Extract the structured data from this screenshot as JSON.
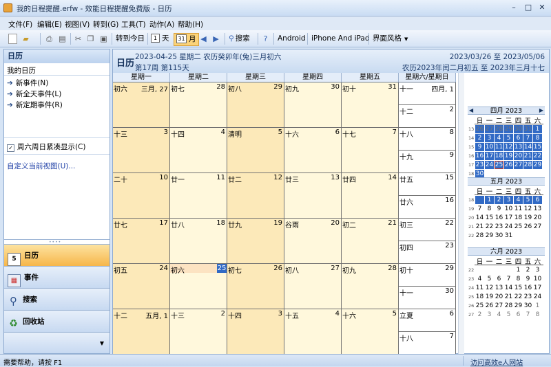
{
  "window": {
    "title": "我的日程提醒.erfw - 效能日程提醒免费版 - 日历",
    "min_label": "–",
    "max_label": "□",
    "close_label": "✕"
  },
  "menu": [
    "文件(F)",
    "编辑(E)",
    "视图(V)",
    "转到(G)",
    "工具(T)",
    "动作(A)",
    "帮助(H)"
  ],
  "toolbar": {
    "goto_today": "转到今日",
    "day_label": "天",
    "day_icon": "1",
    "month_label": "月",
    "month_icon": "31",
    "search": "搜索",
    "android": "Android",
    "iphone": "iPhone And iPad",
    "style": "界面风格"
  },
  "left": {
    "header": "日历",
    "my_calendar": "我的日历",
    "actions": [
      "新事件(N)",
      "新全天事件(L)",
      "新定期事件(R)"
    ],
    "compact_weekend": "周六周日紧凑显示(C)",
    "custom_view": "自定义当前视图(U)...",
    "nav": [
      "日历",
      "事件",
      "搜索",
      "回收站"
    ],
    "nav_icons": [
      "calendar-icon",
      "events-icon",
      "search-icon",
      "recycle-icon"
    ]
  },
  "calendar": {
    "title": "日历",
    "date_line": "2023-04-25 星期二 农历癸卯年(兔)三月初六",
    "week_line": "第17周 第115天",
    "range": "2023/03/26 至 2023/05/06",
    "lunar_range": "农历2023年闰二月初五 至 2023年三月十七",
    "weekdays": [
      "星期一",
      "星期二",
      "星期三",
      "星期四",
      "星期五",
      "星期六/星期日"
    ],
    "weeks": [
      {
        "days": [
          [
            "初六",
            "三月, 27"
          ],
          [
            "初七",
            "28"
          ],
          [
            "初八",
            "29"
          ],
          [
            "初九",
            "30"
          ],
          [
            "初十",
            "31"
          ]
        ],
        "weekend": [
          [
            "十一",
            "四月, 1"
          ],
          [
            "十二",
            "2"
          ]
        ]
      },
      {
        "days": [
          [
            "十三",
            "3"
          ],
          [
            "十四",
            "4"
          ],
          [
            "清明",
            "5"
          ],
          [
            "十六",
            "6"
          ],
          [
            "十七",
            "7"
          ]
        ],
        "weekend": [
          [
            "十八",
            "8"
          ],
          [
            "十九",
            "9"
          ]
        ]
      },
      {
        "days": [
          [
            "二十",
            "10"
          ],
          [
            "廿一",
            "11"
          ],
          [
            "廿二",
            "12"
          ],
          [
            "廿三",
            "13"
          ],
          [
            "廿四",
            "14"
          ]
        ],
        "weekend": [
          [
            "廿五",
            "15"
          ],
          [
            "廿六",
            "16"
          ]
        ]
      },
      {
        "days": [
          [
            "廿七",
            "17"
          ],
          [
            "廿八",
            "18"
          ],
          [
            "廿九",
            "19"
          ],
          [
            "谷雨",
            "20"
          ],
          [
            "初二",
            "21"
          ]
        ],
        "weekend": [
          [
            "初三",
            "22"
          ],
          [
            "初四",
            "23"
          ]
        ]
      },
      {
        "days": [
          [
            "初五",
            "24"
          ],
          [
            "初六",
            "25"
          ],
          [
            "初七",
            "26"
          ],
          [
            "初八",
            "27"
          ],
          [
            "初九",
            "28"
          ]
        ],
        "weekend": [
          [
            "初十",
            "29"
          ],
          [
            "十一",
            "30"
          ]
        ]
      },
      {
        "days": [
          [
            "十二",
            "五月, 1"
          ],
          [
            "十三",
            "2"
          ],
          [
            "十四",
            "3"
          ],
          [
            "十五",
            "4"
          ],
          [
            "十六",
            "5"
          ]
        ],
        "weekend": [
          [
            "立夏",
            "6"
          ],
          [
            "十八",
            "7"
          ]
        ]
      }
    ]
  },
  "mini": {
    "dow": [
      "日",
      "一",
      "二",
      "三",
      "四",
      "五",
      "六"
    ],
    "months": [
      {
        "title": "四月 2023",
        "weeks": [
          "13",
          "14",
          "15",
          "16",
          "17",
          "18"
        ],
        "rows": [
          [
            "26",
            "27",
            "28",
            "29",
            "30",
            "31",
            "1"
          ],
          [
            "2",
            "3",
            "4",
            "5",
            "6",
            "7",
            "8"
          ],
          [
            "9",
            "10",
            "11",
            "12",
            "13",
            "14",
            "15"
          ],
          [
            "16",
            "17",
            "18",
            "19",
            "20",
            "21",
            "22"
          ],
          [
            "23",
            "24",
            "25",
            "26",
            "27",
            "28",
            "29"
          ],
          [
            "30",
            "",
            "",
            "",
            "",
            "",
            ""
          ]
        ]
      },
      {
        "title": "五月 2023",
        "weeks": [
          "18",
          "19",
          "20",
          "21",
          "22"
        ],
        "rows": [
          [
            "",
            "1",
            "2",
            "3",
            "4",
            "5",
            "6"
          ],
          [
            "7",
            "8",
            "9",
            "10",
            "11",
            "12",
            "13"
          ],
          [
            "14",
            "15",
            "16",
            "17",
            "18",
            "19",
            "20"
          ],
          [
            "21",
            "22",
            "23",
            "24",
            "25",
            "26",
            "27"
          ],
          [
            "28",
            "29",
            "30",
            "31",
            "",
            "",
            ""
          ]
        ]
      },
      {
        "title": "六月 2023",
        "weeks": [
          "22",
          "23",
          "24",
          "25",
          "26",
          "27"
        ],
        "rows": [
          [
            "",
            "",
            "",
            "",
            "1",
            "2",
            "3"
          ],
          [
            "4",
            "5",
            "6",
            "7",
            "8",
            "9",
            "10"
          ],
          [
            "11",
            "12",
            "13",
            "14",
            "15",
            "16",
            "17"
          ],
          [
            "18",
            "19",
            "20",
            "21",
            "22",
            "23",
            "24"
          ],
          [
            "25",
            "26",
            "27",
            "28",
            "29",
            "30",
            "1"
          ],
          [
            "2",
            "3",
            "4",
            "5",
            "6",
            "7",
            "8"
          ]
        ]
      }
    ]
  },
  "status": {
    "left": "需要帮助，请按 F1",
    "right": "访问高效e人网站"
  }
}
